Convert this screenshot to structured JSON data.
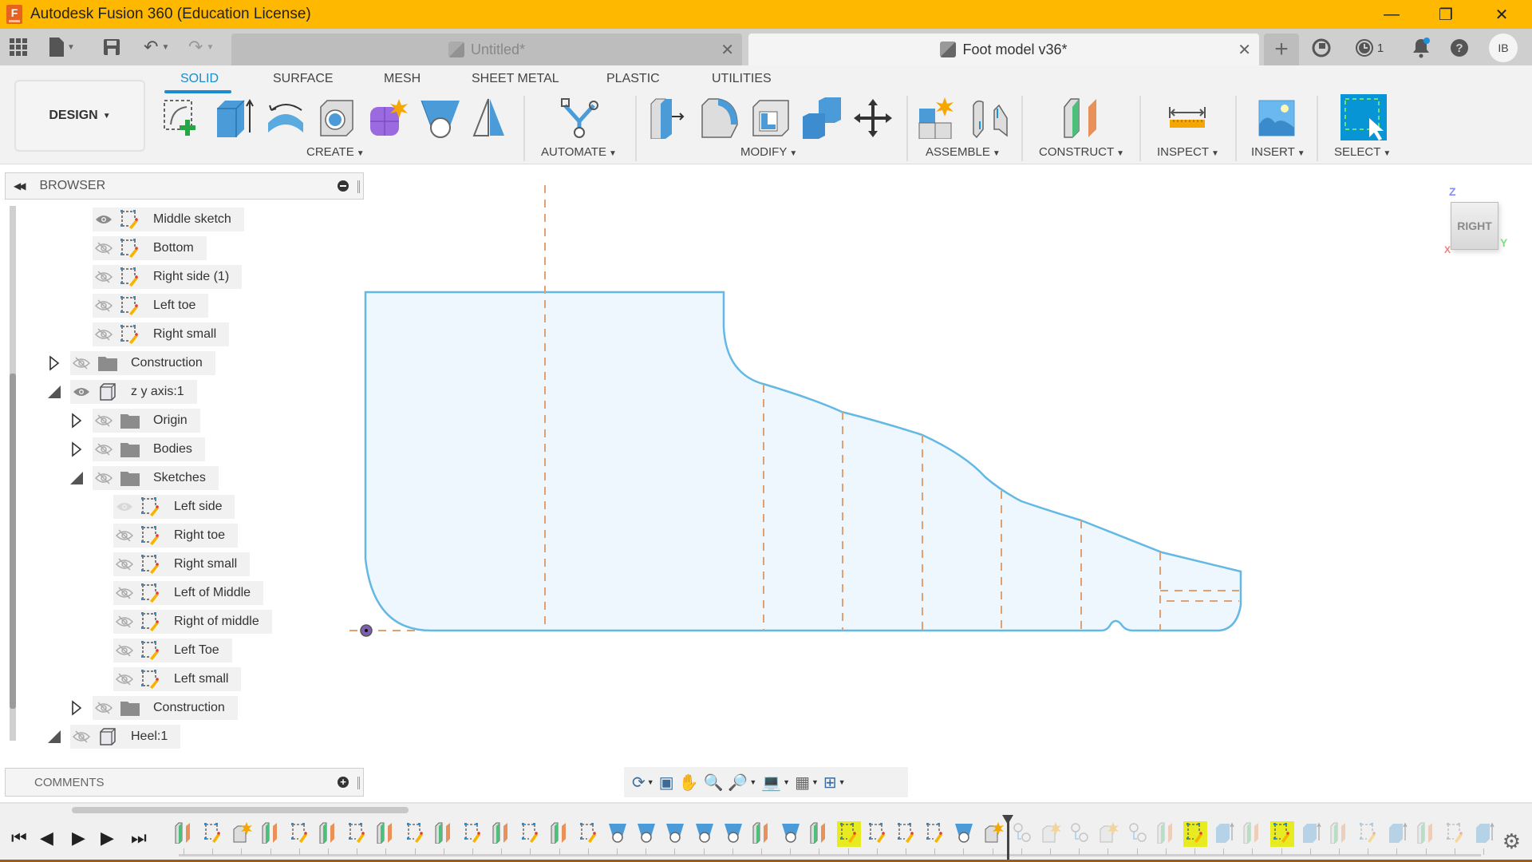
{
  "app": {
    "title": "Autodesk Fusion 360 (Education License)",
    "window_controls": [
      "minimize",
      "restore",
      "close"
    ]
  },
  "quick_access": {
    "grid_icon": "apps-grid-icon",
    "file_icon": "file-icon",
    "save_icon": "save-icon",
    "undo_icon": "undo-icon",
    "redo_icon": "redo-icon"
  },
  "tabs": [
    {
      "label": "Untitled*",
      "active": false
    },
    {
      "label": "Foot model v36*",
      "active": true
    }
  ],
  "right_toolbar": {
    "new_tab": "+",
    "job_status_count": "1",
    "avatar_initials": "IB"
  },
  "ribbon": {
    "workspace": "DESIGN",
    "tabs": [
      "SOLID",
      "SURFACE",
      "MESH",
      "SHEET METAL",
      "PLASTIC",
      "UTILITIES"
    ],
    "active_tab": "SOLID",
    "groups": [
      {
        "label": "CREATE",
        "tools": [
          "create-sketch",
          "extrude",
          "revolve",
          "hole",
          "form",
          "loft",
          "pattern"
        ]
      },
      {
        "label": "AUTOMATE",
        "tools": [
          "automate"
        ]
      },
      {
        "label": "MODIFY",
        "tools": [
          "press-pull",
          "fillet",
          "shell",
          "combine",
          "move"
        ]
      },
      {
        "label": "ASSEMBLE",
        "tools": [
          "new-component",
          "joint"
        ]
      },
      {
        "label": "CONSTRUCT",
        "tools": [
          "offset-plane"
        ]
      },
      {
        "label": "INSPECT",
        "tools": [
          "measure"
        ]
      },
      {
        "label": "INSERT",
        "tools": [
          "insert-image"
        ]
      },
      {
        "label": "SELECT",
        "tools": [
          "select"
        ]
      }
    ]
  },
  "browser": {
    "title": "BROWSER",
    "nodes": [
      {
        "label": "Middle sketch",
        "type": "sketch",
        "visible": true,
        "level": 2
      },
      {
        "label": "Bottom",
        "type": "sketch",
        "visible": false,
        "level": 2
      },
      {
        "label": "Right side (1)",
        "type": "sketch",
        "visible": false,
        "level": 2
      },
      {
        "label": "Left toe",
        "type": "sketch",
        "visible": false,
        "level": 2
      },
      {
        "label": "Right small",
        "type": "sketch",
        "visible": false,
        "level": 2
      },
      {
        "label": "Construction",
        "type": "folder",
        "visible": false,
        "level": 1,
        "expander": "collapsed"
      },
      {
        "label": "z y axis:1",
        "type": "component",
        "visible": true,
        "level": 1,
        "expander": "expanded"
      },
      {
        "label": "Origin",
        "type": "folder",
        "visible": false,
        "level": 2,
        "expander": "collapsed"
      },
      {
        "label": "Bodies",
        "type": "folder",
        "visible": false,
        "level": 2,
        "expander": "collapsed"
      },
      {
        "label": "Sketches",
        "type": "folder",
        "visible": false,
        "level": 2,
        "expander": "expanded"
      },
      {
        "label": "Left side",
        "type": "sketch",
        "visible": "faded",
        "level": 3
      },
      {
        "label": "Right toe",
        "type": "sketch",
        "visible": false,
        "level": 3
      },
      {
        "label": "Right small",
        "type": "sketch",
        "visible": false,
        "level": 3
      },
      {
        "label": "Left of Middle",
        "type": "sketch",
        "visible": false,
        "level": 3
      },
      {
        "label": "Right of middle",
        "type": "sketch",
        "visible": false,
        "level": 3
      },
      {
        "label": "Left Toe",
        "type": "sketch",
        "visible": false,
        "level": 3
      },
      {
        "label": "Left small",
        "type": "sketch",
        "visible": false,
        "level": 3
      },
      {
        "label": "Construction",
        "type": "folder",
        "visible": false,
        "level": 2,
        "expander": "collapsed"
      },
      {
        "label": "Heel:1",
        "type": "component",
        "visible": false,
        "level": 1,
        "expander": "expanded"
      }
    ]
  },
  "comments": {
    "title": "COMMENTS"
  },
  "viewcube": {
    "face": "RIGHT",
    "axes": {
      "z": "Z",
      "y": "Y",
      "x": "X"
    }
  },
  "navbar": {
    "tools": [
      "orbit",
      "look-at",
      "pan",
      "zoom",
      "fit",
      "display-settings",
      "grid-settings",
      "viewports"
    ]
  },
  "timeline": {
    "controls": [
      "first",
      "previous",
      "play",
      "next",
      "last"
    ],
    "features": [
      "plane",
      "sketch",
      "form",
      "plane",
      "sketch",
      "plane",
      "sketch",
      "plane",
      "sketch",
      "plane",
      "sketch",
      "plane",
      "sketch",
      "plane",
      "sketch",
      "loft",
      "loft",
      "loft",
      "loft",
      "loft",
      "plane",
      "loft",
      "plane",
      "sketch-hl",
      "sketch",
      "sketch",
      "sketch",
      "loft",
      "form",
      "joint",
      "form",
      "joint",
      "form",
      "joint",
      "plane",
      "sketch-hl",
      "extrude",
      "plane",
      "sketch-hl",
      "extrude",
      "plane",
      "sketch",
      "extrude",
      "plane",
      "sketch",
      "extrude"
    ],
    "marker_after_index": 28
  },
  "colors": {
    "title_bar": "#ffb800",
    "accent": "#1b8ccf",
    "sketch_line": "#63b8e4",
    "sketch_fill": "#eef7fd",
    "construction_line": "#e0a070",
    "timeline_highlight": "#e7ec22"
  }
}
